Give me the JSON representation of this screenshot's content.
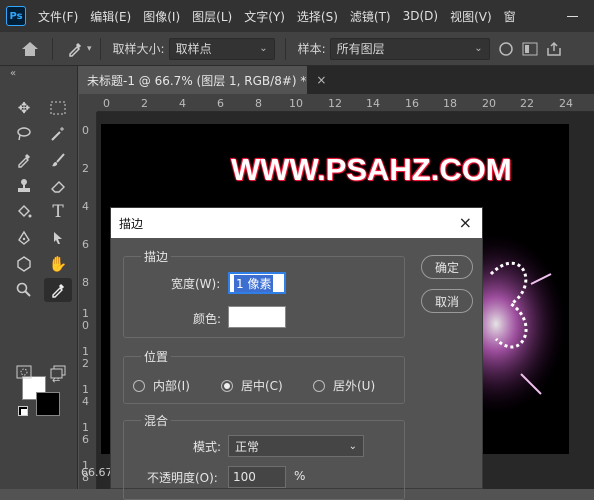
{
  "menubar": {
    "logo": "Ps",
    "items": [
      "文件(F)",
      "编辑(E)",
      "图像(I)",
      "图层(L)",
      "文字(Y)",
      "选择(S)",
      "滤镜(T)",
      "3D(D)",
      "视图(V)",
      "窗"
    ]
  },
  "options": {
    "sample_size_label": "取样大小:",
    "sample_size_value": "取样点",
    "sample_label": "样本:",
    "sample_value": "所有图层"
  },
  "toolbar": {
    "collapse": "«",
    "tools": [
      "move",
      "marquee",
      "lasso",
      "magic-wand",
      "eyedropper",
      "brush",
      "stamp",
      "eraser",
      "paint-bucket",
      "type",
      "pen",
      "path-select",
      "shape",
      "hand",
      "zoom",
      "color-sampler",
      "edit-quick-mask",
      "screen-mode"
    ]
  },
  "document": {
    "tab_title": "未标题-1 @ 66.7% (图层 1, RGB/8#) *",
    "tab_close": "×",
    "ruler_h": [
      "0",
      "2",
      "4",
      "6",
      "8",
      "10",
      "12",
      "14",
      "16",
      "18",
      "20",
      "22",
      "24"
    ],
    "ruler_v": [
      "0",
      "2",
      "4",
      "6",
      "8",
      "1\n0",
      "1\n2",
      "1\n4",
      "1\n6",
      "1\n8"
    ],
    "canvas_text": "WWW.PSAHZ.COM",
    "zoom": "66.67"
  },
  "dialog": {
    "title": "描边",
    "close": "×",
    "stroke_group": "描边",
    "width_label": "宽度(W):",
    "width_value": "1 像素",
    "color_label": "颜色:",
    "location_group": "位置",
    "inside_label": "内部(I)",
    "center_label": "居中(C)",
    "outside_label": "居外(U)",
    "blend_group": "混合",
    "mode_label": "模式:",
    "mode_value": "正常",
    "opacity_label": "不透明度(O):",
    "opacity_value": "100",
    "opacity_unit": "%",
    "ok": "确定",
    "cancel": "取消"
  }
}
